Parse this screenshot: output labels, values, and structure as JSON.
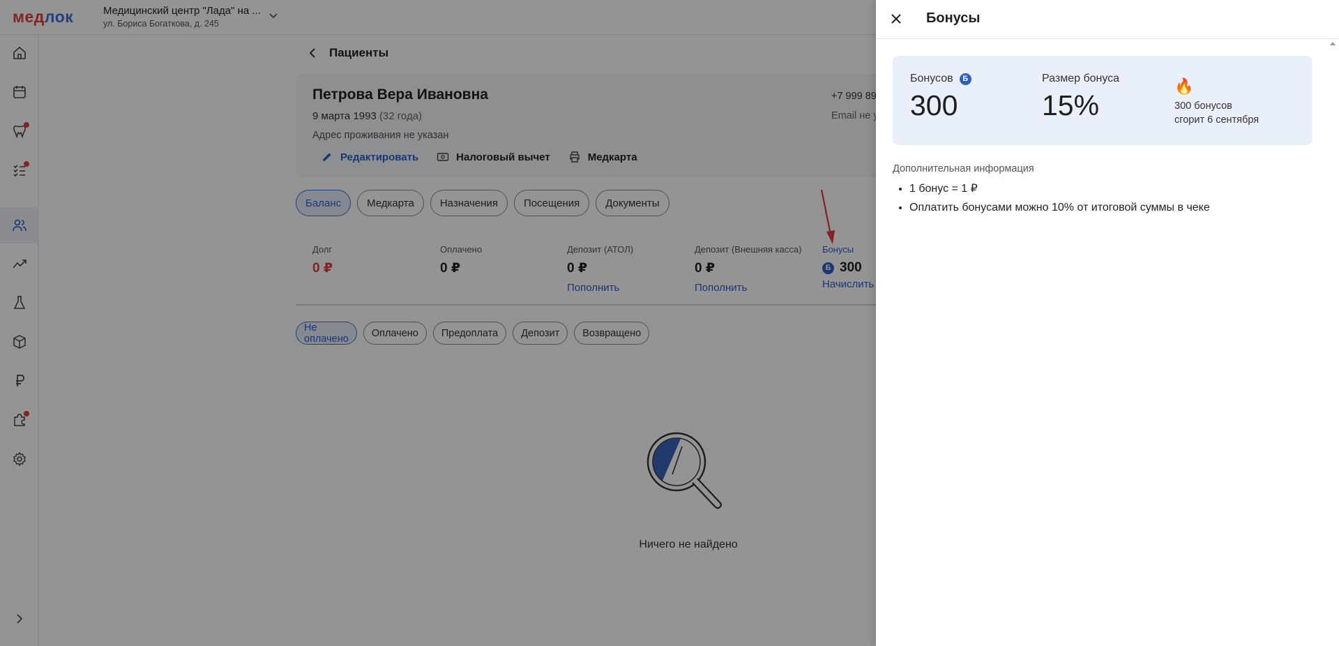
{
  "header": {
    "logo_part1": "мед",
    "logo_part2": "лок",
    "clinic_name": "Медицинский центр \"Лада\" на ...",
    "clinic_address": "ул. Бориса Богаткова, д. 245"
  },
  "breadcrumb": {
    "back_title": "Пациенты"
  },
  "patient": {
    "name": "Петрова Вера Ивановна",
    "birth_date": "9 марта 1993",
    "age": "(32 года)",
    "address": "Адрес проживания не указан",
    "phone": "+7 999 89",
    "email": "Email не у",
    "actions": {
      "edit": "Редактировать",
      "tax": "Налоговый вычет",
      "medcard": "Медкарта"
    }
  },
  "tabs": [
    "Баланс",
    "Медкарта",
    "Назначения",
    "Посещения",
    "Документы"
  ],
  "balance": {
    "debt": {
      "label": "Долг",
      "value": "0 ₽"
    },
    "paid": {
      "label": "Оплачено",
      "value": "0 ₽"
    },
    "deposit_atol": {
      "label": "Депозит (АТОЛ)",
      "value": "0 ₽",
      "link": "Пополнить"
    },
    "deposit_ext": {
      "label": "Депозит (Внешняя касса)",
      "value": "0 ₽",
      "link": "Пополнить"
    },
    "bonuses": {
      "label": "Бонусы",
      "coin": "Б",
      "value": "300",
      "link": "Начислить"
    }
  },
  "filters": [
    "Не оплачено",
    "Оплачено",
    "Предоплата",
    "Депозит",
    "Возвращено"
  ],
  "empty": {
    "text": "Ничего не найдено"
  },
  "drawer": {
    "title": "Бонусы",
    "bonus_label": "Бонусов",
    "bonus_coin": "Б",
    "bonus_value": "300",
    "size_label": "Размер бонуса",
    "size_value": "15%",
    "fire_glyph": "🔥",
    "expire_line1": "300 бонусов",
    "expire_line2": "сгорит 6 сентября",
    "info_title": "Дополнительная информация",
    "info_items": [
      "1 бонус = 1 ₽",
      "Оплатить бонусами можно 10% от итоговой суммы в чеке"
    ]
  },
  "colors": {
    "accent": "#2b5fcc",
    "debt": "#e53b3b",
    "card_bg": "#eaf0fa"
  }
}
